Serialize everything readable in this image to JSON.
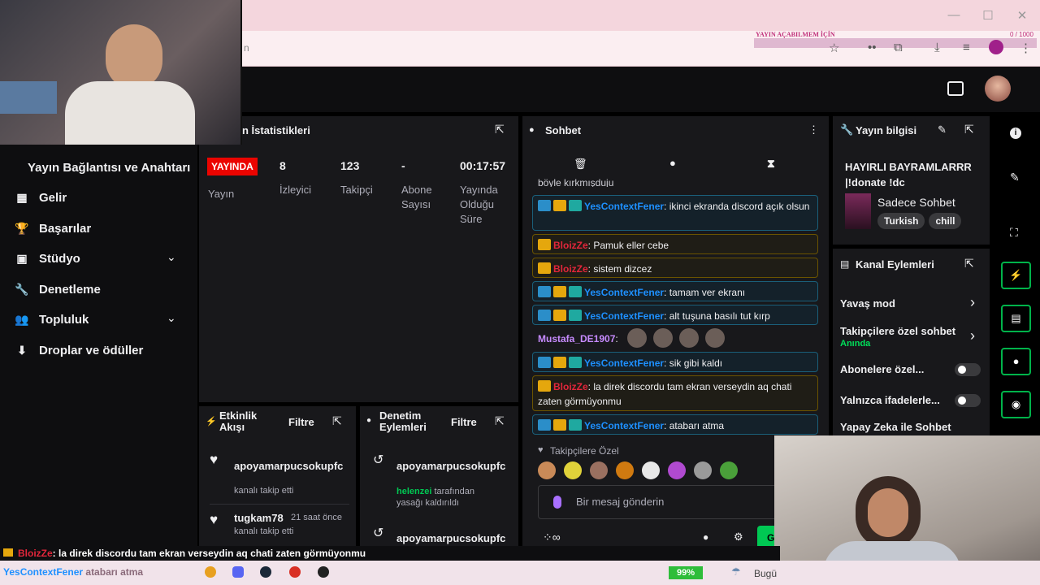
{
  "browser": {
    "overlay_title": "YAYIN AÇABILMEM İÇİN",
    "overlay_count": "0 / 1000",
    "minimize": "—",
    "maximize": "☐",
    "close": "✕"
  },
  "sidebar": {
    "connection_label": "Yayın Bağlantısı ve Anahtarı",
    "items": [
      {
        "label": "Gelir",
        "icon": "▦"
      },
      {
        "label": "Başarılar",
        "icon": "🏆"
      },
      {
        "label": "Stüdyo",
        "icon": "▣",
        "chevron": "⌄"
      },
      {
        "label": "Denetleme",
        "icon": "🔧"
      },
      {
        "label": "Topluluk",
        "icon": "👥",
        "chevron": "⌄"
      },
      {
        "label": "Droplar ve ödüller",
        "icon": "⬇"
      }
    ]
  },
  "stats": {
    "title": "n İstatistikleri",
    "live_badge": "YAYINDA",
    "live_label": "Yayın",
    "viewers_value": "8",
    "viewers_label": "İzleyici",
    "followers_value": "123",
    "followers_label": "Takipçi",
    "subs_value": "-",
    "subs_label_1": "Abone",
    "subs_label_2": "Sayısı",
    "time_value": "00:17:57",
    "time_label_1": "Yayında",
    "time_label_2": "Olduğu",
    "time_label_3": "Süre"
  },
  "activity": {
    "title_1": "Etkinlik",
    "title_2": "Akışı",
    "filter": "Filtre",
    "items": [
      {
        "user": "apoyamarpucsokupfc",
        "desc": "kanalı takip etti",
        "time": ""
      },
      {
        "user": "tugkam78",
        "desc": "kanalı takip etti",
        "time": "21 saat önce"
      }
    ]
  },
  "moderation": {
    "title_1": "Denetim",
    "title_2": "Eylemleri",
    "filter": "Filtre",
    "item1_user": "apoyamarpucsokupfc",
    "item2_mod": "helenzei",
    "item2_text_1": "tarafından",
    "item2_text_2": "yasağı kaldırıldı",
    "item3_user": "apoyamarpucsokupfc"
  },
  "chat": {
    "title": "Sohbet",
    "partial": "böyle kırkmışduju",
    "messages": [
      {
        "user": "YesContextFener",
        "text": ": ikinci ekranda discord açık olsun",
        "style": "blue"
      },
      {
        "user": "BloizZe",
        "text": ": Pamuk eller cebe",
        "style": "gold"
      },
      {
        "user": "BloizZe",
        "text": ": sistem dizcez",
        "style": "gold"
      },
      {
        "user": "YesContextFener",
        "text": ": tamam ver ekranı",
        "style": "blue"
      },
      {
        "user": "YesContextFener",
        "text": ": alt tuşuna basılı tut kırp",
        "style": "blue"
      },
      {
        "user": "Mustafa_DE1907",
        "text": ":",
        "style": "plain"
      },
      {
        "user": "YesContextFener",
        "text": ": sik gibi kaldı",
        "style": "blue"
      },
      {
        "user": "BloizZe",
        "text": ": la direk discordu tam ekran verseydin aq chati zaten görmüyonmu",
        "style": "gold"
      },
      {
        "user": "YesContextFener",
        "text": ": atabarı atma",
        "style": "blue"
      }
    ],
    "follower_only": "Takipçilere Özel",
    "input_placeholder": "Bir mesaj gönderin",
    "send_label": "G"
  },
  "stream_info": {
    "title": "Yayın bilgisi",
    "stream_title_1": "HAYIRLI BAYRAMLARRR",
    "stream_title_2": "|!donate !dc",
    "category": "Sadece Sohbet",
    "tags": [
      "Turkish",
      "chill"
    ]
  },
  "channel_actions": {
    "title": "Kanal Eylemleri",
    "slow_mode": "Yavaş mod",
    "followers_chat": "Takipçilere özel sohbet",
    "followers_chat_status": "Anında",
    "subs_only": "Abonelere özel...",
    "emotes_only": "Yalnızca ifadelerle...",
    "ai_chat": "Yapay Zeka ile Sohbet"
  },
  "ticker": {
    "user": "BloizZe",
    "text": ": la direk discordu tam ekran verseydin aq chati zaten görmüyonmu"
  },
  "taskbar": {
    "ticker_user": "YesContextFener",
    "ticker_text": "atabarı atma",
    "battery": "99%",
    "weather": "Bugü"
  },
  "colors": {
    "accent_green": "#00b34a",
    "live_red": "#eb0400",
    "panel_bg": "#18181b"
  }
}
